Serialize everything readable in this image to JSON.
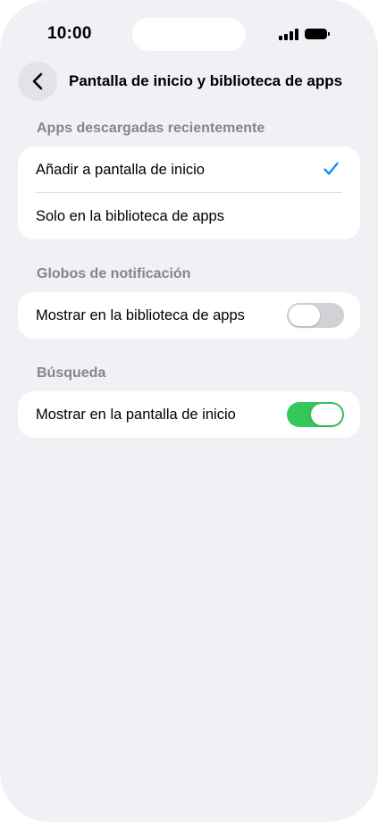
{
  "status_bar": {
    "time": "10:00",
    "icons": [
      "cellular-signal-icon",
      "battery-icon"
    ]
  },
  "nav": {
    "back_icon": "chevron-left-icon",
    "title": "Pantalla de inicio y biblioteca de apps"
  },
  "colors": {
    "background": "#f1f0f5",
    "card": "#ffffff",
    "accent_check": "#0a84ff",
    "toggle_on": "#34c759",
    "toggle_off": "#d1d1d6",
    "section_header": "#85858b"
  },
  "sections": [
    {
      "header": "Apps descargadas recientemente",
      "rows": [
        {
          "label": "Añadir a pantalla de inicio",
          "selected": true
        },
        {
          "label": "Solo en la biblioteca de apps",
          "selected": false
        }
      ]
    },
    {
      "header": "Globos de notificación",
      "rows": [
        {
          "label": "Mostrar en la biblioteca de apps",
          "toggle": false
        }
      ]
    },
    {
      "header": "Búsqueda",
      "rows": [
        {
          "label": "Mostrar en la pantalla de inicio",
          "toggle": true
        }
      ]
    }
  ]
}
